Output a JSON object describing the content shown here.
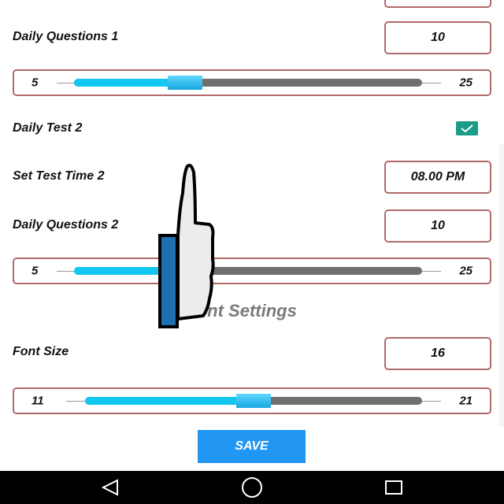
{
  "settings": {
    "daily_questions_1": {
      "label": "Daily Questions 1",
      "value": "10"
    },
    "slider1": {
      "min": "5",
      "max": "25",
      "fill_fraction": 0.32
    },
    "daily_test_2": {
      "label": "Daily Test 2",
      "checked": true
    },
    "set_test_time_2": {
      "label": "Set Test Time 2",
      "value": "08.00 PM"
    },
    "daily_questions_2": {
      "label": "Daily Questions 2",
      "value": "10"
    },
    "slider2": {
      "min": "5",
      "max": "25",
      "fill_fraction": 0.32
    }
  },
  "font_settings": {
    "title": "nt Settings",
    "font_size": {
      "label": "Font Size",
      "value": "16"
    },
    "slider3": {
      "min": "11",
      "max": "21",
      "fill_fraction": 0.5
    }
  },
  "save_label": "SAVE",
  "colors": {
    "border": "#b06a6a",
    "slider_fill": "#12c7f2",
    "slider_track": "#6f6f6f",
    "checkbox": "#1a9c86",
    "save_button": "#2196f3",
    "navbar": "#000000"
  },
  "nav": {
    "back_icon": "back-triangle-icon",
    "home_icon": "home-circle-icon",
    "recents_icon": "recents-square-icon"
  }
}
